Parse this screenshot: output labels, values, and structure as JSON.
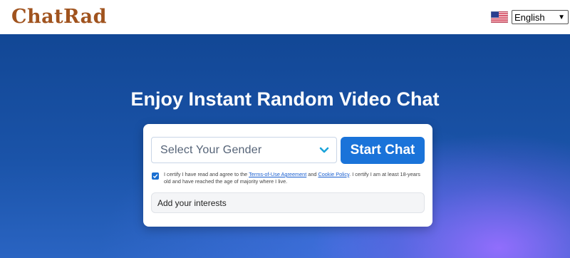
{
  "header": {
    "logo_text": "ChatRad",
    "language": {
      "flag_icon": "us-flag-icon",
      "selected": "English"
    }
  },
  "hero": {
    "headline": "Enjoy Instant Random Video Chat"
  },
  "form": {
    "gender_placeholder": "Select Your Gender",
    "start_button": "Start Chat",
    "consent": {
      "checked": true,
      "text_before": "I certify I have read and agree to the ",
      "terms_link": "Terms-of-Use Agreement",
      "text_and": " and ",
      "cookie_link": "Cookie Policy",
      "text_after": ". I certify I am at least 18-years old and have reached the age of majority where I live."
    },
    "interests_placeholder": "Add your interests"
  },
  "colors": {
    "logo": "#a0531e",
    "hero_top": "#124795",
    "accent_button": "#1a73d9",
    "chevron": "#1aa3d9"
  }
}
